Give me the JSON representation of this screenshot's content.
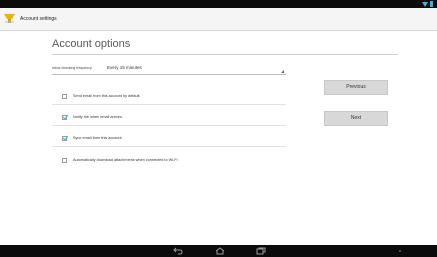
{
  "action_bar": {
    "title": "Account settings",
    "icon": "settings-wrench-icon"
  },
  "page": {
    "title": "Account options"
  },
  "inbox_frequency": {
    "label": "Inbox checking frequency",
    "value": "Every 15 minutes"
  },
  "options": [
    {
      "label": "Send email from this account by default.",
      "checked": false
    },
    {
      "label": "Notify me when email arrives.",
      "checked": true
    },
    {
      "label": "Sync email from this account.",
      "checked": true
    },
    {
      "label": "Automatically download attachments when connected to Wi-Fi",
      "checked": false
    }
  ],
  "buttons": {
    "previous": "Previous",
    "next": "Next"
  },
  "colors": {
    "accent": "#33b5e5",
    "status_bar": "#0b0b0b",
    "action_bar": "#f5f5f5"
  },
  "nav": {
    "icons": [
      "back-icon",
      "home-icon",
      "recent-apps-icon",
      "menu-dots-icon"
    ]
  }
}
